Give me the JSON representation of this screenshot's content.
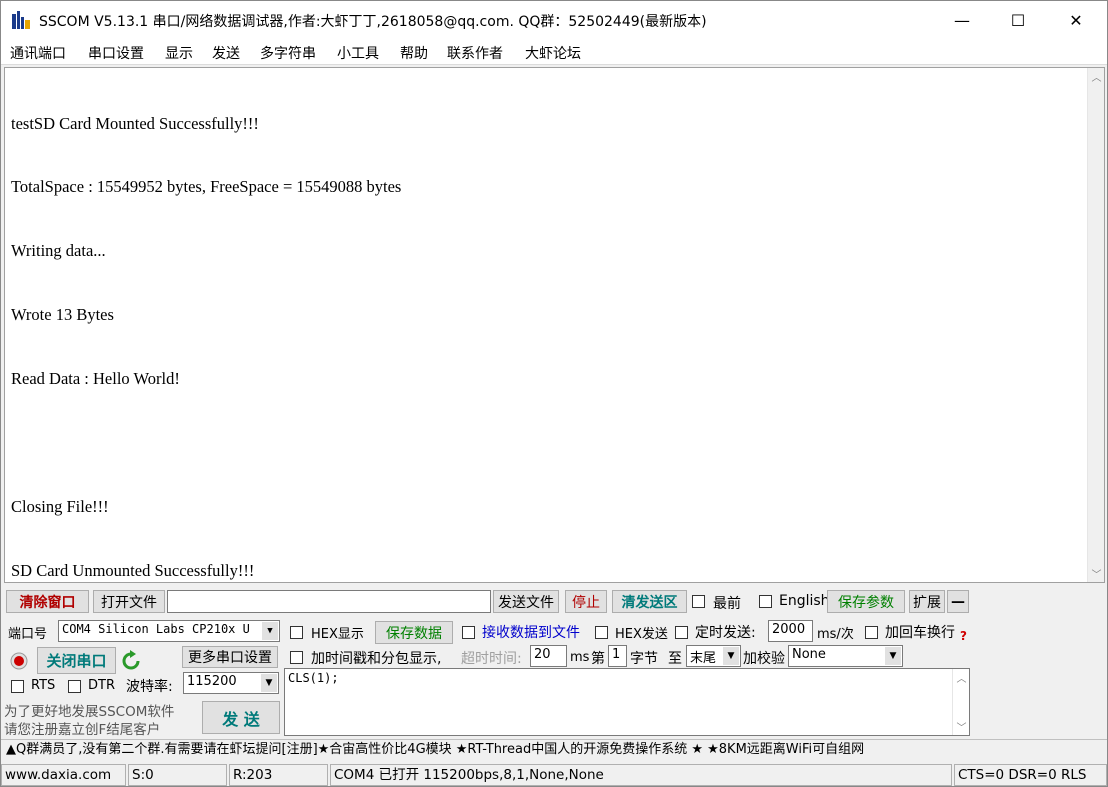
{
  "window": {
    "title": "SSCOM V5.13.1 串口/网络数据调试器,作者:大虾丁丁,2618058@qq.com. QQ群：52502449(最新版本)",
    "minimize_glyph": "—",
    "maximize_glyph": "☐",
    "close_glyph": "✕"
  },
  "menu": [
    "通讯端口",
    "串口设置",
    "显示",
    "发送",
    "多字符串",
    "小工具",
    "帮助",
    "联系作者",
    "大虾论坛"
  ],
  "receive": {
    "lines": [
      "testSD Card Mounted Successfully!!!",
      "TotalSpace : 15549952 bytes, FreeSpace = 15549088 bytes",
      "Writing data...",
      "Wrote 13 Bytes",
      "Read Data : Hello World!",
      "",
      "Closing File!!!",
      "SD Card Unmounted Successfully!!!"
    ]
  },
  "toolbar1": {
    "clear_window": "清除窗口",
    "open_file": "打开文件",
    "file_path": "",
    "send_file": "发送文件",
    "stop": "停止",
    "clear_send": "清发送区",
    "topmost": "最前",
    "english": "English",
    "save_params": "保存参数",
    "expand": "扩展",
    "collapse": "—"
  },
  "port": {
    "port_label": "端口号",
    "port_value": "COM4 Silicon Labs CP210x U",
    "close_port": "关闭串口",
    "more_settings": "更多串口设置",
    "rts": "RTS",
    "dtr": "DTR",
    "baud_label": "波特率:",
    "baud_value": "115200",
    "promo_line1": "为了更好地发展SSCOM软件",
    "promo_line2": "请您注册嘉立创F结尾客户",
    "send_button": "发 送"
  },
  "options": {
    "hex_display": "HEX显示",
    "save_data": "保存数据",
    "recv_to_file": "接收数据到文件",
    "hex_send": "HEX发送",
    "timed_send": "定时发送:",
    "timed_interval": "2000",
    "timed_unit": "ms/次",
    "add_crlf": "加回车换行",
    "timestamp": "加时间戳和分包显示,",
    "timeout_label": "超时时间:",
    "timeout_value": "20",
    "timeout_unit": "ms",
    "byte_prefix": "第",
    "byte_value": "1",
    "byte_suffix": "字节",
    "to_label": "至",
    "to_value": "末尾",
    "checksum_label": "加校验",
    "checksum_value": "None",
    "help_icon": "?"
  },
  "send_area": {
    "text": "CLS(1);"
  },
  "marquee": "▲Q群满员了,没有第二个群.有需要请在虾坛提问[注册]★合宙高性价比4G模块 ★RT-Thread中国人的开源免费操作系统 ★ ★8KM远距离WiFi可自组网",
  "statusbar": {
    "website": "www.daxia.com",
    "sent": "S:0",
    "received": "R:203",
    "port_status": "COM4 已打开  115200bps,8,1,None,None",
    "signals": "CTS=0 DSR=0 RLS"
  },
  "colors": {
    "window_bg": "#f0f0f0",
    "red_button": "#b00000",
    "teal_button": "#007a7a",
    "green_text": "#008000",
    "record_icon": "#cc0000"
  }
}
